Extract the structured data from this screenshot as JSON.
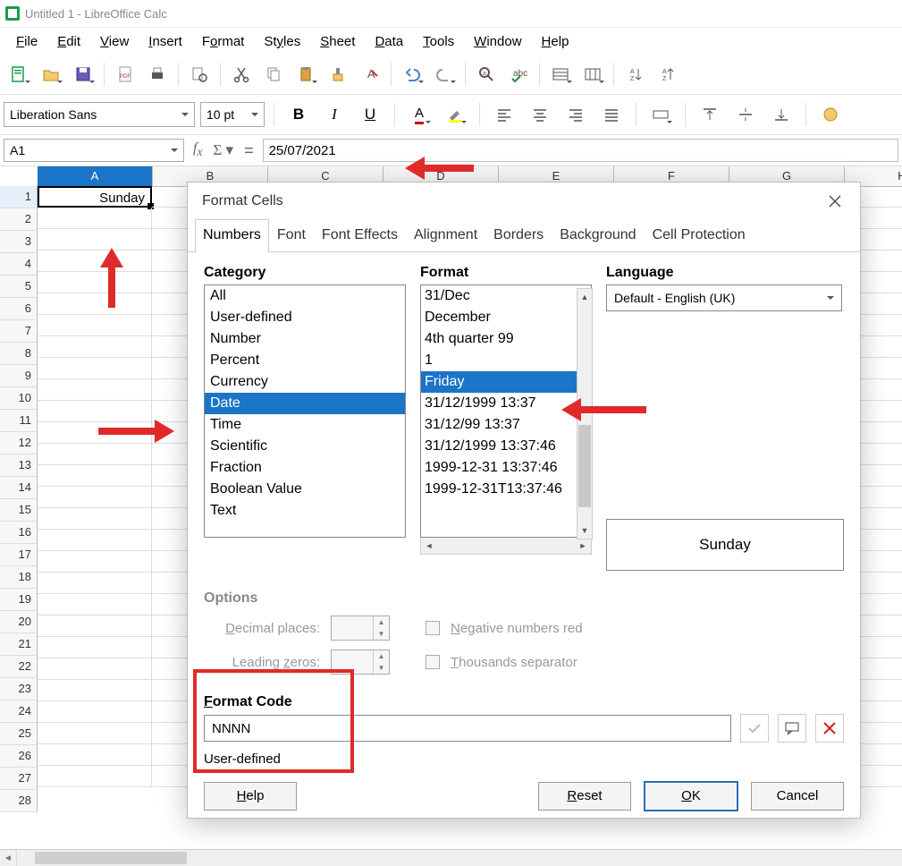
{
  "window": {
    "title": "Untitled 1 - LibreOffice Calc"
  },
  "menus": [
    "File",
    "Edit",
    "View",
    "Insert",
    "Format",
    "Styles",
    "Sheet",
    "Data",
    "Tools",
    "Window",
    "Help"
  ],
  "font": {
    "name": "Liberation Sans",
    "size": "10 pt"
  },
  "cellref": "A1",
  "formula": "25/07/2021",
  "columns": [
    "A",
    "B",
    "C",
    "D",
    "E",
    "F",
    "G",
    "H"
  ],
  "selected_col": 0,
  "rows": 28,
  "cellA1": "Sunday",
  "dialog": {
    "title": "Format Cells",
    "tabs": [
      "Numbers",
      "Font",
      "Font Effects",
      "Alignment",
      "Borders",
      "Background",
      "Cell Protection"
    ],
    "active_tab": 0,
    "category_label": "Category",
    "format_label": "Format",
    "language_label": "Language",
    "categories": [
      "All",
      "User-defined",
      "Number",
      "Percent",
      "Currency",
      "Date",
      "Time",
      "Scientific",
      "Fraction",
      "Boolean Value",
      "Text"
    ],
    "category_selected": "Date",
    "formats": [
      "31/Dec",
      "December",
      "4th quarter 99",
      "1",
      "Friday",
      "31/12/1999 13:37",
      "31/12/99 13:37",
      "31/12/1999 13:37:46",
      "1999-12-31 13:37:46",
      "1999-12-31T13:37:46"
    ],
    "format_selected": "Friday",
    "language": "Default - English (UK)",
    "preview": "Sunday",
    "options_label": "Options",
    "decimal_label": "Decimal places:",
    "leading_label": "Leading zeros:",
    "negative_label": "Negative numbers red",
    "thousands_label": "Thousands separator",
    "formatcode_label": "Format Code",
    "formatcode": "NNNN",
    "formatcode_note": "User-defined",
    "help": "Help",
    "reset": "Reset",
    "ok": "OK",
    "cancel": "Cancel"
  }
}
